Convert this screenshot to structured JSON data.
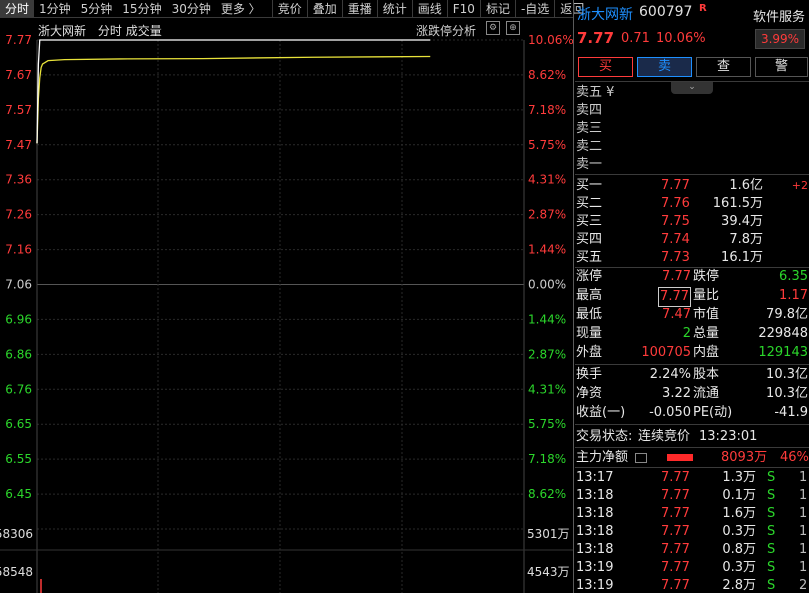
{
  "topbar": {
    "periods": [
      "分时",
      "1分钟",
      "5分钟",
      "15分钟",
      "30分钟",
      "更多 〉"
    ],
    "tools": [
      "竞价",
      "叠加",
      "重播",
      "统计",
      "画线",
      "F10",
      "标记",
      "-自选",
      "返回"
    ]
  },
  "chart": {
    "legend": [
      "浙大网新",
      "分时",
      "成交量"
    ],
    "analysis_label": "涨跌停分析",
    "price_ticks": [
      "7.77",
      "7.67",
      "7.57",
      "7.47",
      "7.36",
      "7.26",
      "7.16",
      "7.06",
      "6.96",
      "6.86",
      "6.76",
      "6.65",
      "6.55",
      "6.45"
    ],
    "pct_ticks": [
      "10.06%",
      "8.62%",
      "7.18%",
      "5.75%",
      "4.31%",
      "2.87%",
      "1.44%",
      "0.00%",
      "1.44%",
      "2.87%",
      "4.31%",
      "5.75%",
      "7.18%",
      "8.62%"
    ],
    "vol_left": [
      "58306",
      "58548"
    ],
    "vol_right": [
      "5301万",
      "4543万"
    ]
  },
  "chart_data": {
    "type": "line",
    "title": "",
    "xlabel": "",
    "ylabel": "",
    "ylim": [
      6.35,
      7.77
    ],
    "prev_close": 7.06,
    "series": [
      {
        "points": [
          [
            0,
            7.47
          ],
          [
            1,
            7.6
          ],
          [
            2,
            7.66
          ],
          [
            3,
            7.69
          ],
          [
            4,
            7.7
          ],
          [
            8,
            7.71
          ],
          [
            20,
            7.713
          ],
          [
            60,
            7.715
          ],
          [
            120,
            7.716
          ],
          [
            200,
            7.72
          ],
          [
            285,
            7.722
          ]
        ]
      },
      {
        "points": [
          [
            0,
            7.47
          ],
          [
            1,
            7.7
          ],
          [
            2,
            7.77
          ],
          [
            285,
            7.77
          ]
        ]
      }
    ]
  },
  "quote": {
    "name": "浙大网新",
    "code": "600797",
    "r_badge": "R",
    "service": "软件服务",
    "price": "7.77",
    "change": "0.71",
    "change_pct": "10.06%",
    "sector_pct": "3.99%",
    "buy": "买",
    "sell": "卖",
    "check": "查",
    "alert": "警"
  },
  "asks": [
    {
      "label": "卖五 ¥",
      "price": "",
      "vol": ""
    },
    {
      "label": "卖四",
      "price": "",
      "vol": ""
    },
    {
      "label": "卖三",
      "price": "",
      "vol": ""
    },
    {
      "label": "卖二",
      "price": "",
      "vol": ""
    },
    {
      "label": "卖一",
      "price": "",
      "vol": ""
    }
  ],
  "bids": [
    {
      "label": "买一",
      "price": "7.77",
      "vol": "1.6亿",
      "extra": "+2"
    },
    {
      "label": "买二",
      "price": "7.76",
      "vol": "161.5万",
      "extra": ""
    },
    {
      "label": "买三",
      "price": "7.75",
      "vol": "39.4万",
      "extra": ""
    },
    {
      "label": "买四",
      "price": "7.74",
      "vol": "7.8万",
      "extra": ""
    },
    {
      "label": "买五",
      "price": "7.73",
      "vol": "16.1万",
      "extra": ""
    }
  ],
  "stats": [
    {
      "l1": "涨停",
      "v1": "7.77",
      "c1": "red",
      "l2": "跌停",
      "v2": "6.35",
      "c2": "green"
    },
    {
      "l1": "最高",
      "v1": "7.77",
      "c1": "red",
      "l2": "量比",
      "v2": "1.17",
      "c2": "red"
    },
    {
      "l1": "最低",
      "v1": "7.47",
      "c1": "red",
      "l2": "市值",
      "v2": "79.8亿",
      "c2": "white"
    },
    {
      "l1": "现量",
      "v1": "2",
      "c1": "green",
      "l2": "总量",
      "v2": "229848",
      "c2": "white"
    },
    {
      "l1": "外盘",
      "v1": "100705",
      "c1": "red",
      "l2": "内盘",
      "v2": "129143",
      "c2": "green"
    }
  ],
  "fund": [
    {
      "l1": "换手",
      "v1": "2.24%",
      "l2": "股本",
      "v2": "10.3亿"
    },
    {
      "l1": "净资",
      "v1": "3.22",
      "l2": "流通",
      "v2": "10.3亿"
    },
    {
      "l1": "收益(一)",
      "v1": "-0.050",
      "l2": "PE(动)",
      "v2": "-41.9"
    }
  ],
  "status": {
    "label": "交易状态:",
    "value": "连续竞价",
    "time": "13:23:01"
  },
  "main_flow": {
    "label": "主力净额",
    "value": "8093万",
    "pct": "46%"
  },
  "trades": [
    {
      "time": "13:17",
      "price": "7.77",
      "vol": "1.3万",
      "side": "S",
      "n": "1"
    },
    {
      "time": "13:18",
      "price": "7.77",
      "vol": "0.1万",
      "side": "S",
      "n": "1"
    },
    {
      "time": "13:18",
      "price": "7.77",
      "vol": "1.6万",
      "side": "S",
      "n": "1"
    },
    {
      "time": "13:18",
      "price": "7.77",
      "vol": "0.3万",
      "side": "S",
      "n": "1"
    },
    {
      "time": "13:18",
      "price": "7.77",
      "vol": "0.8万",
      "side": "S",
      "n": "1"
    },
    {
      "time": "13:19",
      "price": "7.77",
      "vol": "0.3万",
      "side": "S",
      "n": "1"
    },
    {
      "time": "13:19",
      "price": "7.77",
      "vol": "2.8万",
      "side": "S",
      "n": "2"
    }
  ],
  "colors": {
    "up": "#ff3b3b",
    "down": "#2bd62b",
    "avg": "#e8e23a",
    "price_line": "#ffffff",
    "accent": "#1e90ff"
  }
}
